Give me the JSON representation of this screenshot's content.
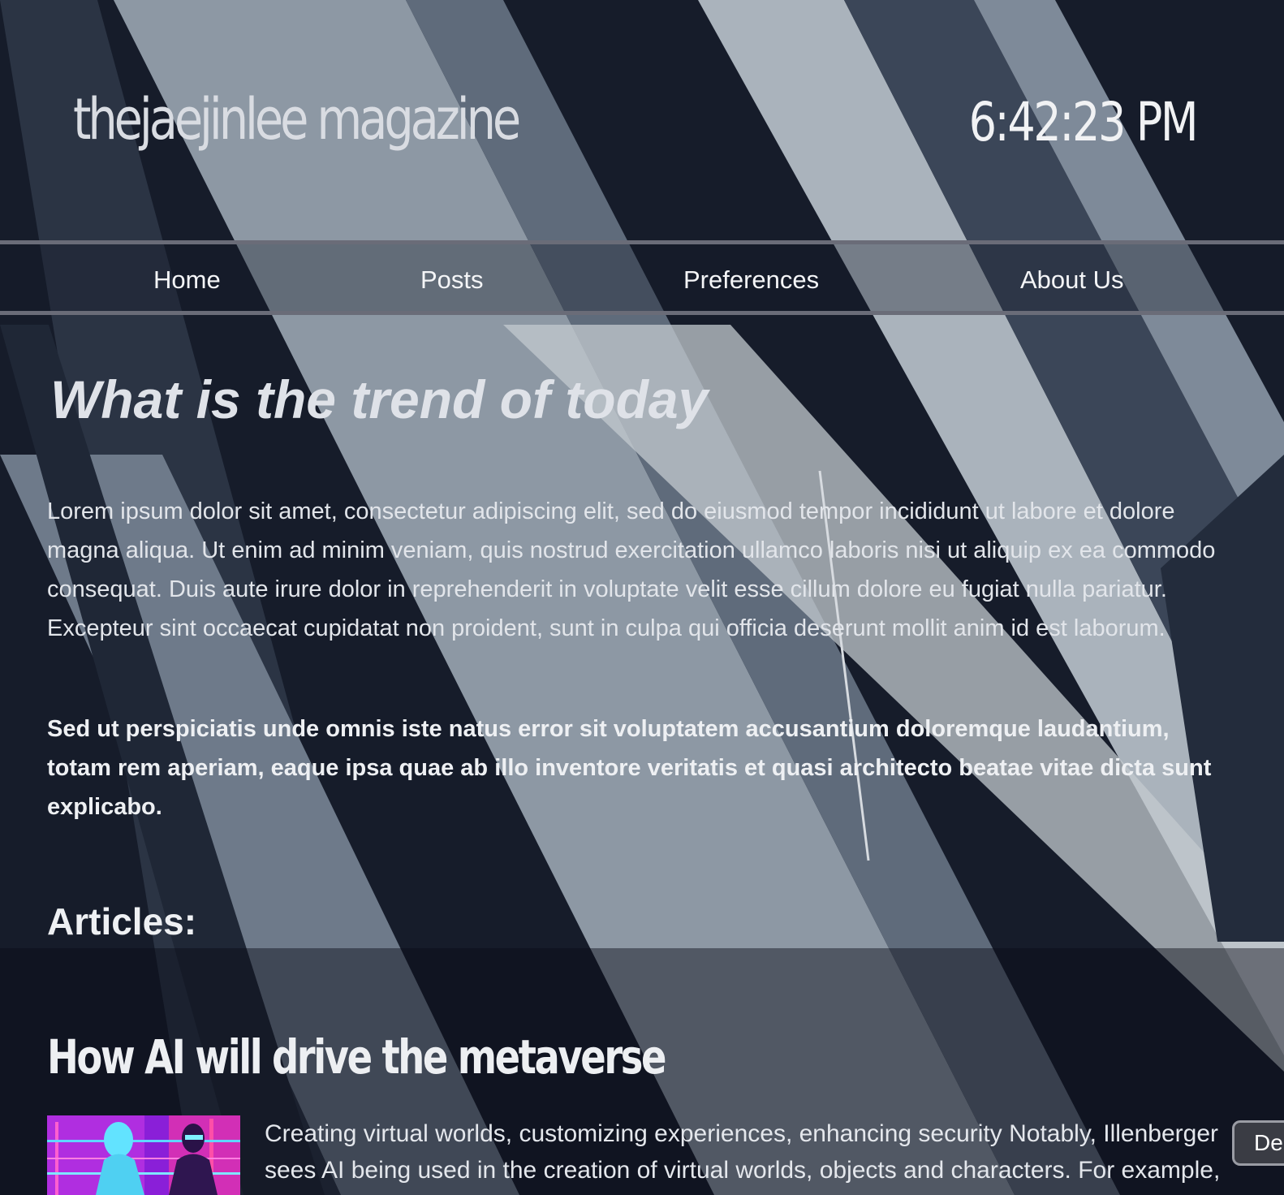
{
  "header": {
    "site_title": "thejaejinlee magazine",
    "clock": "6:42:23 PM"
  },
  "nav": {
    "items": [
      {
        "label": "Home"
      },
      {
        "label": "Posts"
      },
      {
        "label": "Preferences"
      },
      {
        "label": "About Us"
      }
    ]
  },
  "hero": {
    "title": "What is the trend of today",
    "paragraph_1": "Lorem ipsum dolor sit amet, consectetur adipiscing elit, sed do eiusmod tempor incididunt ut labore et dolore magna aliqua. Ut enim ad minim veniam, quis nostrud exercitation ullamco laboris nisi ut aliquip ex ea commodo consequat. Duis aute irure dolor in reprehenderit in voluptate velit esse cillum dolore eu fugiat nulla pariatur. Excepteur sint occaecat cupidatat non proident, sunt in culpa qui officia deserunt mollit anim id est laborum.",
    "paragraph_2": "Sed ut perspiciatis unde omnis iste natus error sit voluptatem accusantium doloremque laudantium, totam rem aperiam, eaque ipsa quae ab illo inventore veritatis et quasi architecto beatae vitae dicta sunt explicabo."
  },
  "articles": {
    "heading": "Articles:",
    "items": [
      {
        "title": "How AI will drive the metaverse",
        "excerpt_line_1": "Creating virtual worlds, customizing experiences, enhancing security Notably, Illenberger",
        "excerpt_line_2": "sees AI being used in the creation of virtual worlds, objects and characters. For example,"
      }
    ]
  },
  "floating_button": {
    "label": "De"
  },
  "colors": {
    "background": "#141a26",
    "nav_border": "#6a6c78",
    "text": "#e6e8ec"
  }
}
